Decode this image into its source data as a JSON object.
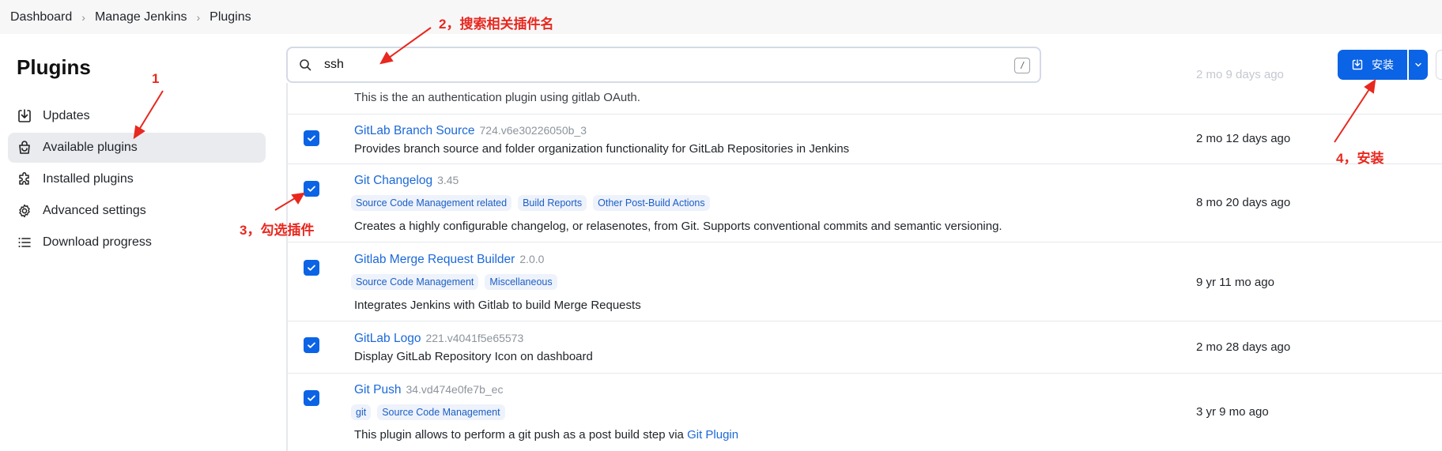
{
  "breadcrumb": [
    "Dashboard",
    "Manage Jenkins",
    "Plugins"
  ],
  "page_title": "Plugins",
  "sidebar": {
    "items": [
      {
        "label": "Updates",
        "icon": "download-icon"
      },
      {
        "label": "Available plugins",
        "icon": "shopping-bag-icon",
        "active": true
      },
      {
        "label": "Installed plugins",
        "icon": "puzzle-icon"
      },
      {
        "label": "Advanced settings",
        "icon": "gear-icon"
      },
      {
        "label": "Download progress",
        "icon": "list-icon"
      }
    ]
  },
  "search": {
    "value": "ssh",
    "shortcut": "/"
  },
  "install_button": {
    "label": "安装"
  },
  "partial_row": {
    "desc": "This is the an authentication plugin using gitlab OAuth.",
    "date": "2 mo 9 days ago"
  },
  "plugins": [
    {
      "name": "GitLab Branch Source",
      "version": "724.v6e30226050b_3",
      "tags": [],
      "desc": "Provides branch source and folder organization functionality for GitLab Repositories in Jenkins",
      "date": "2 mo 12 days ago"
    },
    {
      "name": "Git Changelog",
      "version": "3.45",
      "tags": [
        "Source Code Management related",
        "Build Reports",
        "Other Post-Build Actions"
      ],
      "desc": "Creates a highly configurable changelog, or relasenotes, from Git. Supports conventional commits and semantic versioning.",
      "date": "8 mo 20 days ago"
    },
    {
      "name": "Gitlab Merge Request Builder",
      "version": "2.0.0",
      "tags": [
        "Source Code Management",
        "Miscellaneous"
      ],
      "desc": "Integrates Jenkins with Gitlab to build Merge Requests",
      "date": "9 yr 11 mo ago"
    },
    {
      "name": "GitLab Logo",
      "version": "221.v4041f5e65573",
      "tags": [],
      "desc": "Display GitLab Repository Icon on dashboard",
      "date": "2 mo 28 days ago"
    },
    {
      "name": "Git Push",
      "version": "34.vd474e0fe7b_ec",
      "tags": [
        "git",
        "Source Code Management"
      ],
      "desc": "This plugin allows to perform a git push as a post build step via",
      "desc_link": "Git Plugin",
      "date": "3 yr 9 mo ago"
    }
  ],
  "annotations": {
    "step1": "1",
    "step2": "2，搜索相关插件名",
    "step3": "3，勾选插件",
    "step4": "4，安装"
  },
  "colors": {
    "accent": "#0b63e5",
    "annotation": "#e8281f",
    "link": "#1b69d9"
  }
}
